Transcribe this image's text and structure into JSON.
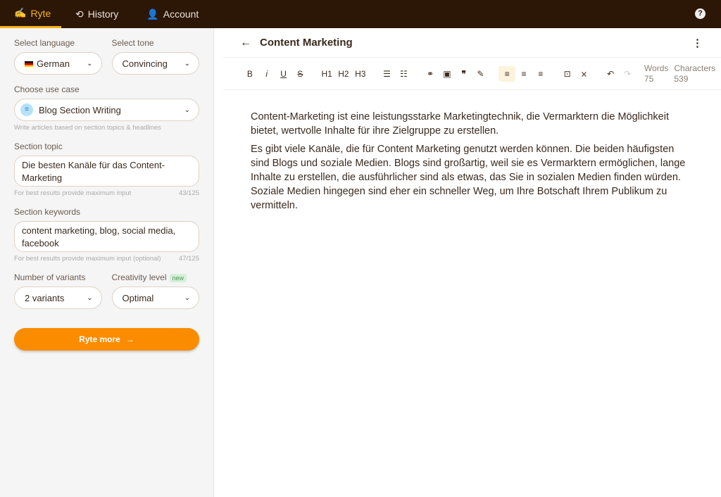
{
  "nav": {
    "tabs": [
      {
        "label": "Ryte",
        "icon": "hand-pen-icon"
      },
      {
        "label": "History",
        "icon": "history-icon"
      },
      {
        "label": "Account",
        "icon": "person-icon"
      }
    ],
    "help_icon": "help-icon"
  },
  "sidebar": {
    "language_label": "Select language",
    "language_value": "German",
    "tone_label": "Select tone",
    "tone_value": "Convincing",
    "usecase_label": "Choose use case",
    "usecase_value": "Blog Section Writing",
    "usecase_hint": "Write articles based on section topics & headlines",
    "topic_label": "Section topic",
    "topic_value": "Die besten Kanäle für das Content-Marketing",
    "topic_hint": "For best results provide maximum input",
    "topic_count": "43/125",
    "keywords_label": "Section keywords",
    "keywords_value": "content marketing, blog, social media, facebook",
    "keywords_hint": "For best results provide maximum input (optional)",
    "keywords_count": "47/125",
    "variants_label": "Number of variants",
    "variants_value": "2 variants",
    "creativity_label": "Creativity level",
    "creativity_badge": "new",
    "creativity_value": "Optimal",
    "submit_label": "Ryte more",
    "accent": "#fb8c00"
  },
  "editor": {
    "title": "Content Marketing",
    "toolbar": [
      "B",
      "i",
      "U",
      "S",
      "H1",
      "H2",
      "H3"
    ],
    "words_label": "Words",
    "words_value": "75",
    "chars_label": "Characters",
    "chars_value": "539",
    "paragraphs": [
      "Content-Marketing ist eine leistungsstarke Marketingtechnik, die Vermarktern die Möglichkeit bietet, wertvolle Inhalte für ihre Zielgruppe zu erstellen.",
      "Es gibt viele Kanäle, die für Content Marketing genutzt werden können. Die beiden häufigsten sind Blogs und soziale Medien. Blogs sind großartig, weil sie es Vermarktern ermöglichen, lange Inhalte zu erstellen, die ausführlicher sind als etwas, das Sie in sozialen Medien finden würden. Soziale Medien hingegen sind eher ein schneller Weg, um Ihre Botschaft Ihrem Publikum zu vermitteln."
    ]
  }
}
